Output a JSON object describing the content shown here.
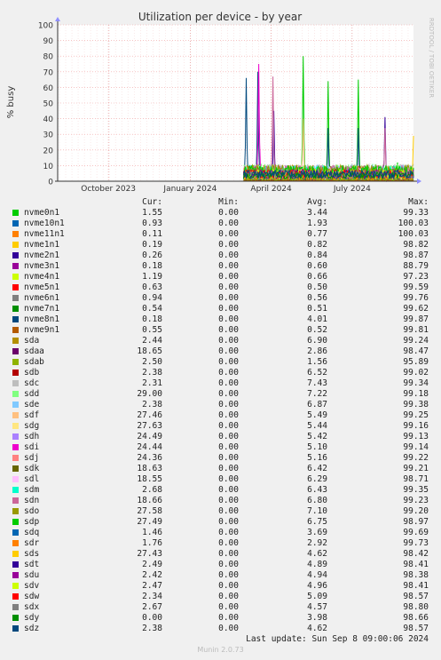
{
  "chart_data": {
    "type": "line",
    "title": "Utilization per device - by year",
    "ylabel": "% busy",
    "ylim": [
      0,
      100
    ],
    "yticks": [
      0,
      10,
      20,
      30,
      40,
      50,
      60,
      70,
      80,
      90,
      100
    ],
    "xticks": [
      "October 2023",
      "January 2024",
      "April 2024",
      "July 2024"
    ],
    "watermark": "RRDTOOL / TOBI OETIKER",
    "columns": [
      "Cur:",
      "Min:",
      "Avg:",
      "Max:"
    ],
    "series": [
      {
        "name": "nvme0n1",
        "color": "#00cc00",
        "cur": "1.55",
        "min": "0.00",
        "avg": "3.44",
        "max": "99.33"
      },
      {
        "name": "nvme10n1",
        "color": "#0066b3",
        "cur": "0.93",
        "min": "0.00",
        "avg": "1.93",
        "max": "100.03"
      },
      {
        "name": "nvme11n1",
        "color": "#ff8000",
        "cur": "0.11",
        "min": "0.00",
        "avg": "0.77",
        "max": "100.03"
      },
      {
        "name": "nvme1n1",
        "color": "#ffcc00",
        "cur": "0.19",
        "min": "0.00",
        "avg": "0.82",
        "max": "98.82"
      },
      {
        "name": "nvme2n1",
        "color": "#330099",
        "cur": "0.26",
        "min": "0.00",
        "avg": "0.84",
        "max": "98.87"
      },
      {
        "name": "nvme3n1",
        "color": "#990099",
        "cur": "0.18",
        "min": "0.00",
        "avg": "0.60",
        "max": "88.79"
      },
      {
        "name": "nvme4n1",
        "color": "#ccff00",
        "cur": "1.19",
        "min": "0.00",
        "avg": "0.66",
        "max": "97.23"
      },
      {
        "name": "nvme5n1",
        "color": "#ff0000",
        "cur": "0.63",
        "min": "0.00",
        "avg": "0.50",
        "max": "99.59"
      },
      {
        "name": "nvme6n1",
        "color": "#808080",
        "cur": "0.94",
        "min": "0.00",
        "avg": "0.56",
        "max": "99.76"
      },
      {
        "name": "nvme7n1",
        "color": "#008f00",
        "cur": "0.54",
        "min": "0.00",
        "avg": "0.51",
        "max": "99.62"
      },
      {
        "name": "nvme8n1",
        "color": "#00487d",
        "cur": "0.18",
        "min": "0.00",
        "avg": "4.01",
        "max": "99.87"
      },
      {
        "name": "nvme9n1",
        "color": "#b35a00",
        "cur": "0.55",
        "min": "0.00",
        "avg": "0.52",
        "max": "99.81"
      },
      {
        "name": "sda",
        "color": "#b38f00",
        "cur": "2.44",
        "min": "0.00",
        "avg": "6.90",
        "max": "99.24"
      },
      {
        "name": "sdaa",
        "color": "#6b006b",
        "cur": "18.65",
        "min": "0.00",
        "avg": "2.86",
        "max": "98.47"
      },
      {
        "name": "sdab",
        "color": "#8fb300",
        "cur": "2.50",
        "min": "0.00",
        "avg": "1.56",
        "max": "95.89"
      },
      {
        "name": "sdb",
        "color": "#b30000",
        "cur": "2.38",
        "min": "0.00",
        "avg": "6.52",
        "max": "99.02"
      },
      {
        "name": "sdc",
        "color": "#bebebe",
        "cur": "2.31",
        "min": "0.00",
        "avg": "7.43",
        "max": "99.34"
      },
      {
        "name": "sdd",
        "color": "#80ff80",
        "cur": "29.00",
        "min": "0.00",
        "avg": "7.22",
        "max": "99.18"
      },
      {
        "name": "sde",
        "color": "#80c9ff",
        "cur": "2.38",
        "min": "0.00",
        "avg": "6.87",
        "max": "99.38"
      },
      {
        "name": "sdf",
        "color": "#ffc080",
        "cur": "27.46",
        "min": "0.00",
        "avg": "5.49",
        "max": "99.25"
      },
      {
        "name": "sdg",
        "color": "#ffe680",
        "cur": "27.63",
        "min": "0.00",
        "avg": "5.44",
        "max": "99.16"
      },
      {
        "name": "sdh",
        "color": "#aa80ff",
        "cur": "24.49",
        "min": "0.00",
        "avg": "5.42",
        "max": "99.13"
      },
      {
        "name": "sdi",
        "color": "#ee00cc",
        "cur": "24.44",
        "min": "0.00",
        "avg": "5.10",
        "max": "99.14"
      },
      {
        "name": "sdj",
        "color": "#ff8080",
        "cur": "24.36",
        "min": "0.00",
        "avg": "5.16",
        "max": "99.22"
      },
      {
        "name": "sdk",
        "color": "#666600",
        "cur": "18.63",
        "min": "0.00",
        "avg": "6.42",
        "max": "99.21"
      },
      {
        "name": "sdl",
        "color": "#ffbfff",
        "cur": "18.55",
        "min": "0.00",
        "avg": "6.29",
        "max": "98.71"
      },
      {
        "name": "sdm",
        "color": "#00ffcc",
        "cur": "2.68",
        "min": "0.00",
        "avg": "6.43",
        "max": "99.35"
      },
      {
        "name": "sdn",
        "color": "#cc6699",
        "cur": "18.66",
        "min": "0.00",
        "avg": "6.80",
        "max": "99.23"
      },
      {
        "name": "sdo",
        "color": "#999900",
        "cur": "27.58",
        "min": "0.00",
        "avg": "7.10",
        "max": "99.20"
      },
      {
        "name": "sdp",
        "color": "#00cc00",
        "cur": "27.49",
        "min": "0.00",
        "avg": "6.75",
        "max": "98.97"
      },
      {
        "name": "sdq",
        "color": "#0066b3",
        "cur": "1.46",
        "min": "0.00",
        "avg": "3.69",
        "max": "99.69"
      },
      {
        "name": "sdr",
        "color": "#ff8000",
        "cur": "1.76",
        "min": "0.00",
        "avg": "2.92",
        "max": "99.73"
      },
      {
        "name": "sds",
        "color": "#ffcc00",
        "cur": "27.43",
        "min": "0.00",
        "avg": "4.62",
        "max": "98.42"
      },
      {
        "name": "sdt",
        "color": "#330099",
        "cur": "2.49",
        "min": "0.00",
        "avg": "4.89",
        "max": "98.41"
      },
      {
        "name": "sdu",
        "color": "#990099",
        "cur": "2.42",
        "min": "0.00",
        "avg": "4.94",
        "max": "98.38"
      },
      {
        "name": "sdv",
        "color": "#ccff00",
        "cur": "2.47",
        "min": "0.00",
        "avg": "4.96",
        "max": "98.41"
      },
      {
        "name": "sdw",
        "color": "#ff0000",
        "cur": "2.34",
        "min": "0.00",
        "avg": "5.09",
        "max": "98.57"
      },
      {
        "name": "sdx",
        "color": "#808080",
        "cur": "2.67",
        "min": "0.00",
        "avg": "4.57",
        "max": "98.80"
      },
      {
        "name": "sdy",
        "color": "#008f00",
        "cur": "0.00",
        "min": "0.00",
        "avg": "3.98",
        "max": "98.66"
      },
      {
        "name": "sdz",
        "color": "#00487d",
        "cur": "2.38",
        "min": "0.00",
        "avg": "4.62",
        "max": "98.57"
      }
    ],
    "spikes": [
      {
        "series": "nvme8n1",
        "date": "2024-03-04",
        "value": 66
      },
      {
        "series": "nvme8n1",
        "date": "2024-03-17",
        "value": 70
      },
      {
        "series": "sdi",
        "date": "2024-03-18",
        "value": 75
      },
      {
        "series": "sdn",
        "date": "2024-04-03",
        "value": 67
      },
      {
        "series": "nvme2n1",
        "date": "2024-04-04",
        "value": 45
      },
      {
        "series": "nvme0n1",
        "date": "2024-05-07",
        "value": 80
      },
      {
        "series": "sdf",
        "date": "2024-05-07",
        "value": 40
      },
      {
        "series": "nvme0n1",
        "date": "2024-06-04",
        "value": 64
      },
      {
        "series": "nvme8n1",
        "date": "2024-06-04",
        "value": 34
      },
      {
        "series": "nvme0n1",
        "date": "2024-07-08",
        "value": 65
      },
      {
        "series": "nvme8n1",
        "date": "2024-07-08",
        "value": 34
      },
      {
        "series": "nvme2n1",
        "date": "2024-08-07",
        "value": 41
      },
      {
        "series": "sdn",
        "date": "2024-08-07",
        "value": 34
      },
      {
        "series": "nvme0n1",
        "date": "2024-08-21",
        "value": 12
      },
      {
        "series": "sds",
        "date": "2024-09-08",
        "value": 29
      }
    ]
  },
  "footer": {
    "last_update": "Last update: Sun Sep  8 09:00:06 2024",
    "version": "Munin 2.0.73"
  }
}
